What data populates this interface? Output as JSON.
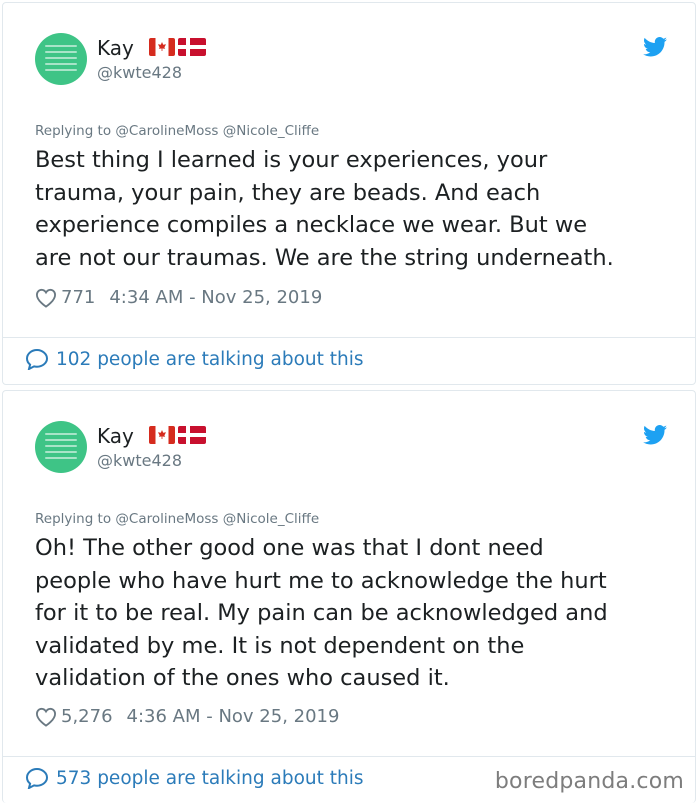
{
  "colors": {
    "text": "#1c2022",
    "secondary": "#697882",
    "link": "#2b7bb9",
    "twitter_blue": "#1da1f2",
    "avatar_green": "#3ec486",
    "border": "#e1e8ed"
  },
  "tweets": [
    {
      "display_name": "Kay",
      "handle": "@kwte428",
      "flags": [
        "canada-flag-icon",
        "denmark-flag-icon"
      ],
      "replying_label": "Replying to",
      "replying_to": "@CarolineMoss @Nicole_Cliffe",
      "text": "Best thing I learned is your experiences, your\ntrauma, your pain, they are beads.  And each\nexperience compiles a necklace we wear.  But we\nare not our traumas.  We are the string underneath.",
      "likes": "771",
      "timestamp": "4:34 AM - Nov 25, 2019",
      "talking": "102 people are talking about this"
    },
    {
      "display_name": "Kay",
      "handle": "@kwte428",
      "flags": [
        "canada-flag-icon",
        "denmark-flag-icon"
      ],
      "replying_label": "Replying to",
      "replying_to": "@CarolineMoss @Nicole_Cliffe",
      "text": "Oh!  The other good one was that I dont need\npeople who have hurt me to acknowledge the hurt\nfor it to be real.  My pain can be acknowledged and\nvalidated by me.  It is not dependent on the\nvalidation of the ones who caused it.",
      "likes": "5,276",
      "timestamp": "4:36 AM - Nov 25, 2019",
      "talking": "573 people are talking about this"
    }
  ],
  "watermark": "boredpanda.com"
}
